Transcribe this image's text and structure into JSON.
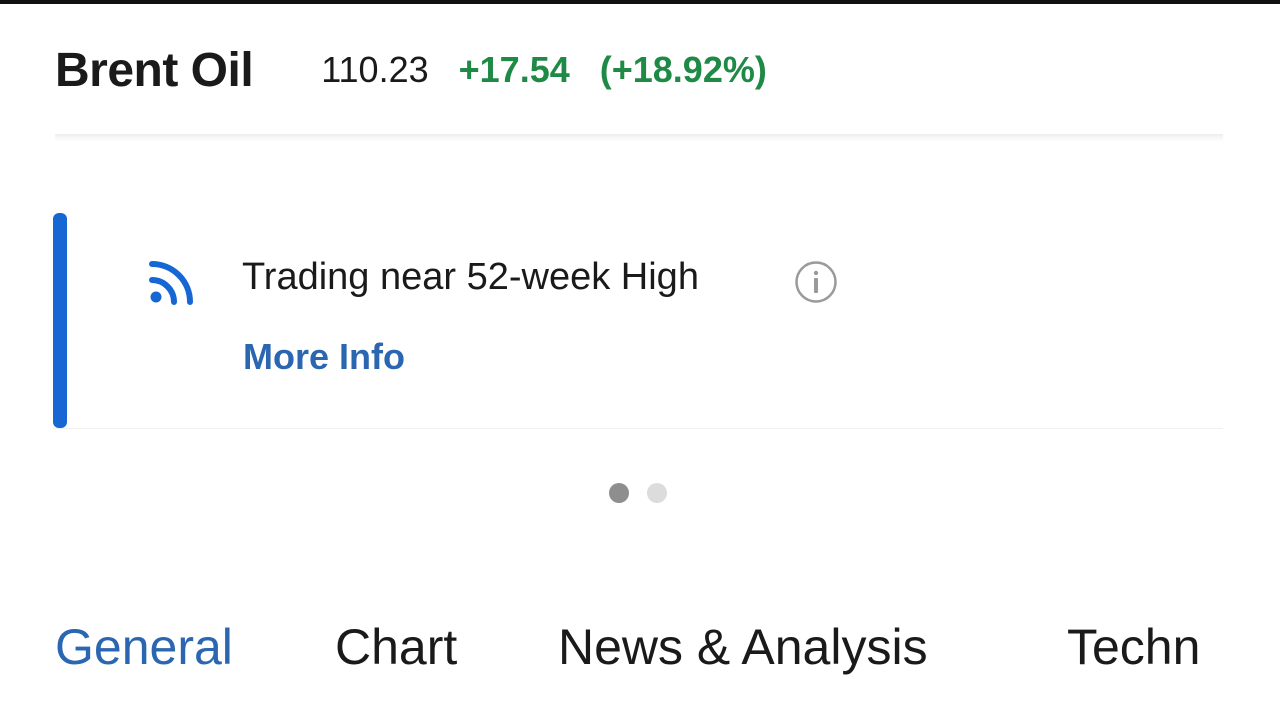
{
  "header": {
    "instrument_name": "Brent Oil",
    "price": "110.23",
    "change": "+17.54",
    "change_percent": "(+18.92%)"
  },
  "signal": {
    "icon": "rss-feed-icon",
    "title": "Trading near 52-week High",
    "info_icon": "info-circle-icon",
    "link_label": "More Info"
  },
  "pager": {
    "pages": 2,
    "active_index": 0
  },
  "tabs": [
    {
      "label": "General",
      "active": true
    },
    {
      "label": "Chart",
      "active": false
    },
    {
      "label": "News & Analysis",
      "active": false
    },
    {
      "label": "Techn",
      "active": false
    }
  ],
  "colors": {
    "positive": "#1f8a46",
    "accent": "#1667d4",
    "link": "#2b66b1"
  }
}
